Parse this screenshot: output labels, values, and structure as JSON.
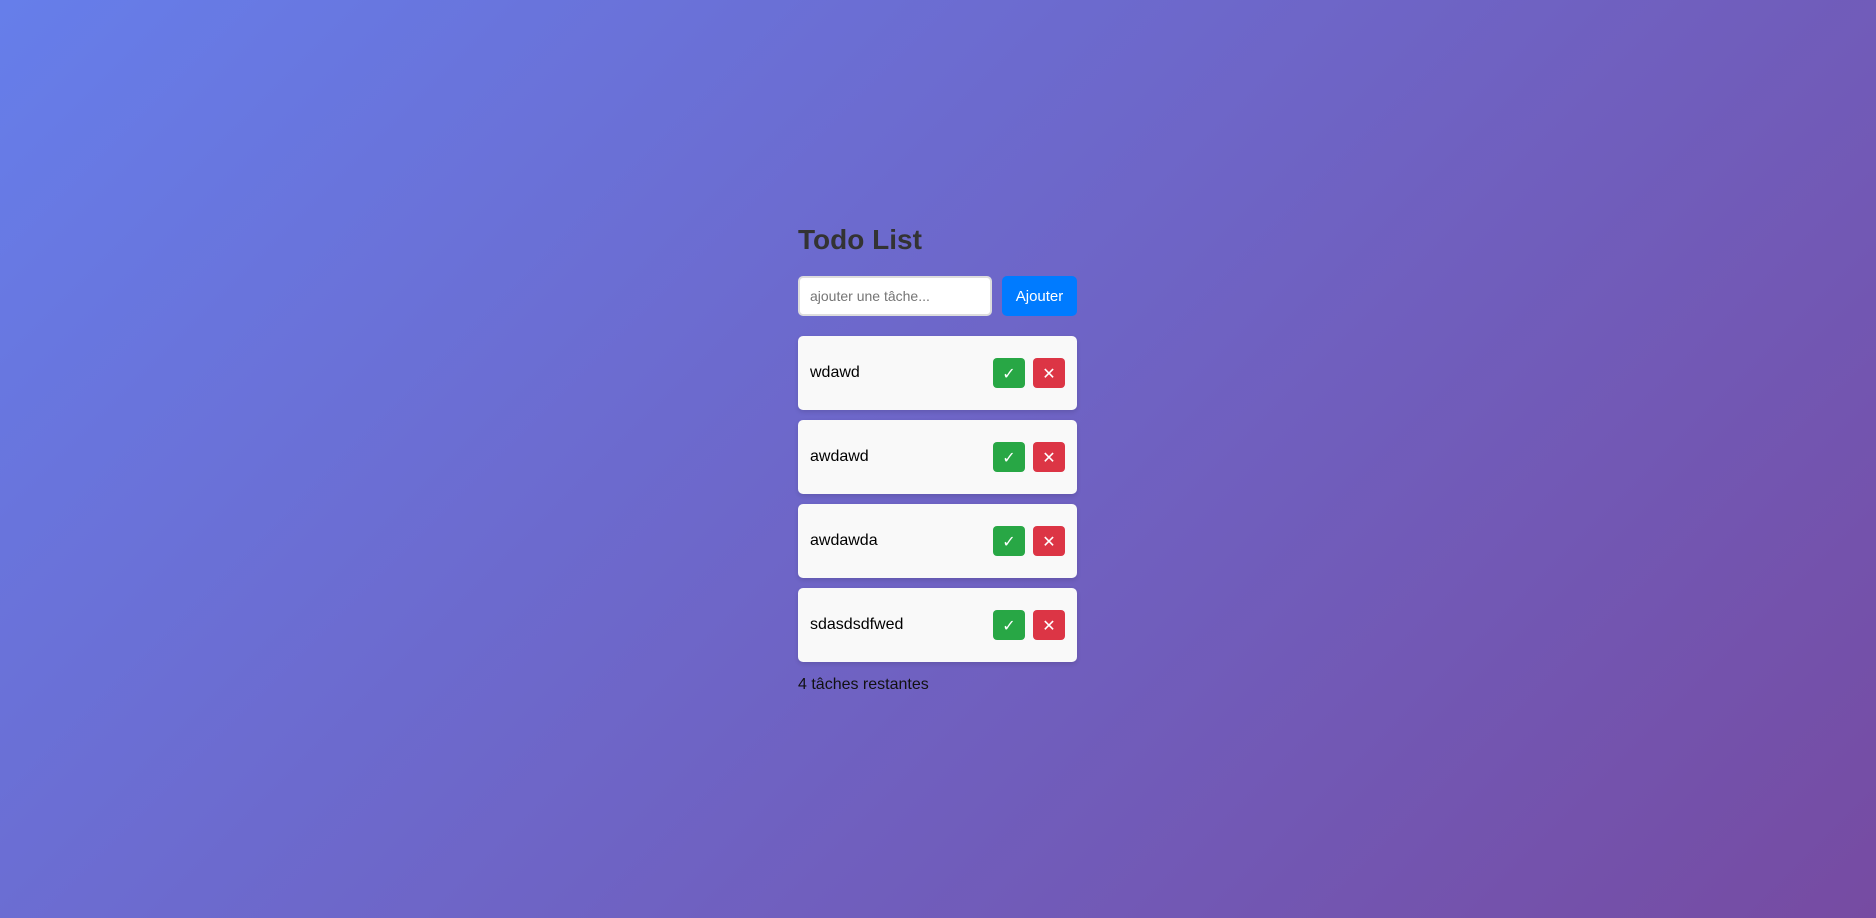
{
  "app": {
    "title": "Todo List"
  },
  "input": {
    "placeholder": "ajouter une tâche...",
    "value": ""
  },
  "add_button": {
    "label": "Ajouter"
  },
  "tasks": [
    {
      "text": "wdawd",
      "complete_icon": "✓",
      "delete_icon": "✕"
    },
    {
      "text": "awdawd",
      "complete_icon": "✓",
      "delete_icon": "✕"
    },
    {
      "text": "awdawda",
      "complete_icon": "✓",
      "delete_icon": "✕"
    },
    {
      "text": "sdasdsdfwed",
      "complete_icon": "✓",
      "delete_icon": "✕"
    }
  ],
  "footer": {
    "remaining_text": "4 tâches restantes"
  },
  "colors": {
    "background_start": "#667eea",
    "background_end": "#764ba2",
    "primary": "#007bff",
    "success": "#28a745",
    "danger": "#dc3545",
    "card": "#f9f9f9"
  },
  "icons": {
    "complete": "check-icon",
    "delete": "close-icon"
  }
}
